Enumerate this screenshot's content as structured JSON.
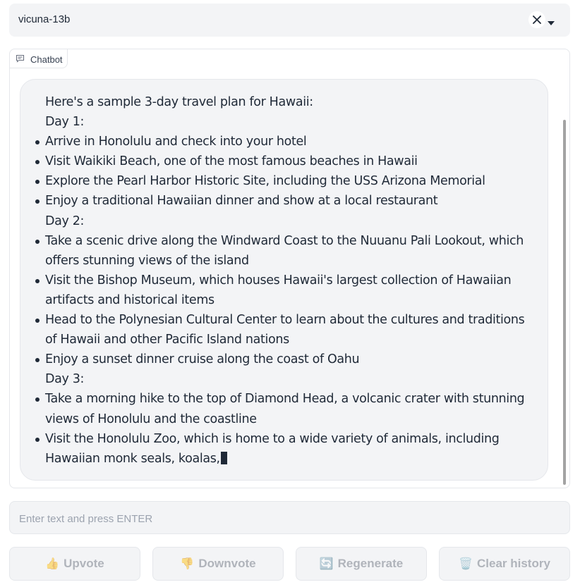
{
  "model_select": {
    "value": "vicuna-13b"
  },
  "chatbot": {
    "label": "Chatbot",
    "message": {
      "intro": "Here's a sample 3-day travel plan for Hawaii:",
      "days": [
        {
          "title": "Day 1:",
          "items": [
            "Arrive in Honolulu and check into your hotel",
            "Visit Waikiki Beach, one of the most famous beaches in Hawaii",
            "Explore the Pearl Harbor Historic Site, including the USS Arizona Memorial",
            "Enjoy a traditional Hawaiian dinner and show at a local restaurant"
          ]
        },
        {
          "title": "Day 2:",
          "items": [
            "Take a scenic drive along the Windward Coast to the Nuuanu Pali Lookout, which offers stunning views of the island",
            "Visit the Bishop Museum, which houses Hawaii's largest collection of Hawaiian artifacts and historical items",
            "Head to the Polynesian Cultural Center to learn about the cultures and traditions of Hawaii and other Pacific Island nations",
            "Enjoy a sunset dinner cruise along the coast of Oahu"
          ]
        },
        {
          "title": "Day 3:",
          "items": [
            "Take a morning hike to the top of Diamond Head, a volcanic crater with stunning views of Honolulu and the coastline",
            "Visit the Honolulu Zoo, which is home to a wide variety of animals, including Hawaiian monk seals, koalas,"
          ]
        }
      ]
    }
  },
  "input": {
    "placeholder": "Enter text and press ENTER",
    "value": ""
  },
  "buttons": {
    "upvote": {
      "emoji": "👍",
      "label": "Upvote"
    },
    "downvote": {
      "emoji": "👎",
      "label": "Downvote"
    },
    "regenerate": {
      "emoji": "🔄",
      "label": "Regenerate"
    },
    "clear": {
      "emoji": "🗑️",
      "label": "Clear history"
    }
  },
  "colors": {
    "panel_bg": "#f3f4f6",
    "border": "#e5e7eb",
    "text": "#1f2937",
    "disabled_text": "#b0b4bb"
  }
}
